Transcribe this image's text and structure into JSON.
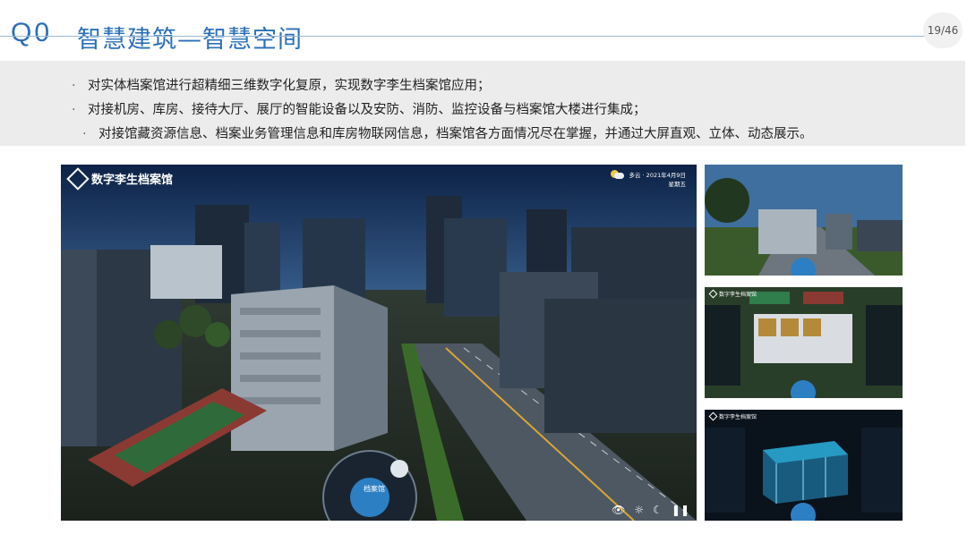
{
  "header": {
    "code": "Q0",
    "title": "智慧建筑—智慧空间",
    "page": "19/46"
  },
  "bullets": [
    "对实体档案馆进行超精细三维数字化复原，实现数字李生档案馆应用；",
    "对接机房、库房、接待大厅、展厅的智能设备以及安防、消防、监控设备与档案馆大楼进行集成；",
    "对接馆藏资源信息、档案业务管理信息和库房物联网信息，档案馆各方面情况尽在掌握，并通过大屏直观、立体、动态展示。"
  ],
  "bullet_marker": "·",
  "main_screen": {
    "app_title": "数字李生档案馆",
    "weather_line1": "多云 · 2021年4月9日",
    "weather_line2": "星期五",
    "wheel_label": "档案馆",
    "icons": [
      "eye-icon",
      "sun-icon",
      "moon-icon",
      "pause-icon"
    ]
  },
  "thumbnails": [
    {
      "name": "city-street-view"
    },
    {
      "name": "floor-plan-dashboard"
    },
    {
      "name": "building-xray-dashboard"
    }
  ],
  "colors": {
    "brand": "#2a6fb8",
    "bullet_band": "#ececec",
    "sky_top": "#0f2a52",
    "sky_bottom": "#7fa9cf",
    "road": "#4d5863",
    "grass": "#4c6a32",
    "accent_cyan": "#2ec5f0"
  }
}
